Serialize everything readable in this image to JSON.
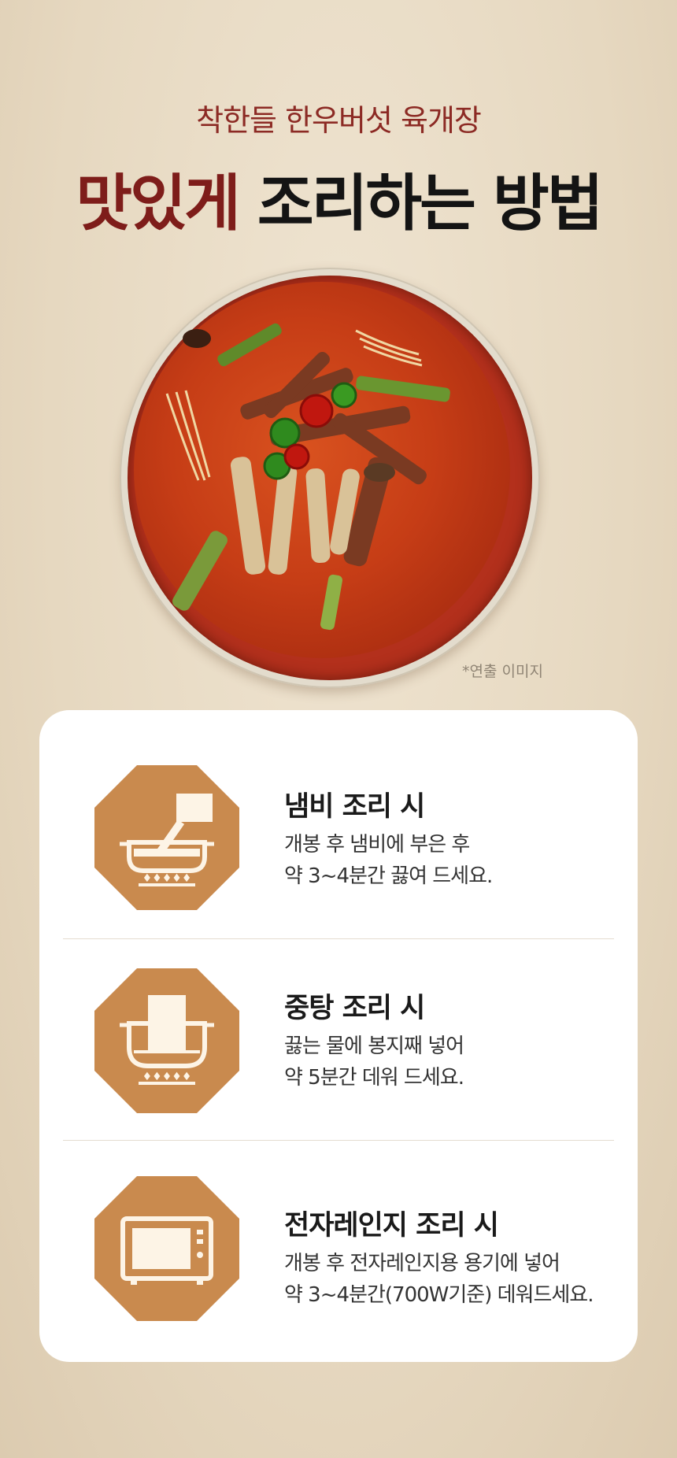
{
  "header": {
    "subtitle": "착한들 한우버섯 육개장",
    "title_accent": "맛있게",
    "title_rest": "조리하는 방법"
  },
  "hero": {
    "caption": "*연출 이미지"
  },
  "colors": {
    "accent": "#7e1d1a",
    "icon_bg": "#c98a4e",
    "icon_fg": "#fdf4e6"
  },
  "steps": [
    {
      "icon": "pot-on-stove-icon",
      "heading": "냄비 조리 시",
      "line1": "개봉 후 냄비에 부은 후",
      "line2": "약 3~4분간 끓여 드세요."
    },
    {
      "icon": "boiling-pouch-icon",
      "heading": "중탕 조리 시",
      "line1": "끓는 물에 봉지째 넣어",
      "line2": "약 5분간 데워 드세요."
    },
    {
      "icon": "microwave-icon",
      "heading": "전자레인지 조리 시",
      "line1": "개봉 후 전자레인지용 용기에 넣어",
      "line2": "약 3~4분간(700W기준) 데워드세요."
    }
  ]
}
